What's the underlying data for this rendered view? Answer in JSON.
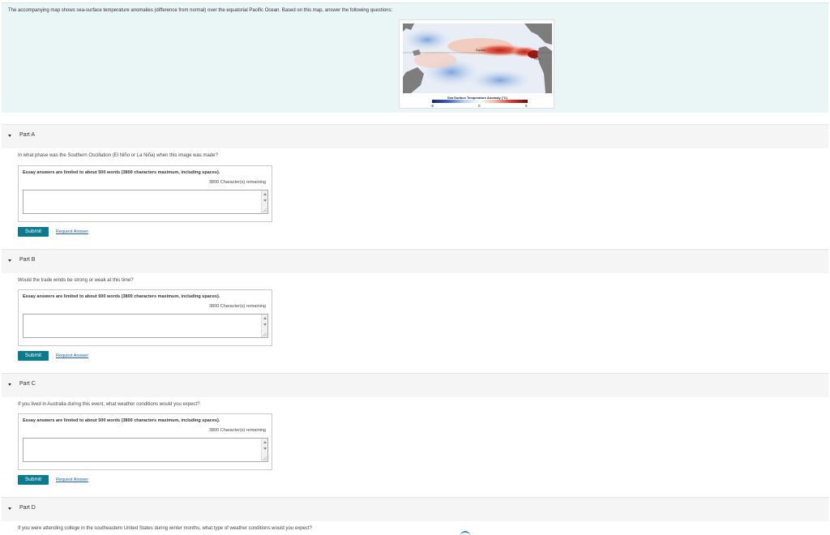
{
  "intro": {
    "text": "The accompanying map shows sea-surface temperature anomalies (difference from normal) over the equatorial Pacific Ocean. Based on this map, answer the following questions:",
    "map": {
      "equator_label": "Equator",
      "peru_label": "Peru",
      "legend_title": "Sea Surface Temperature Anomaly (°C)",
      "legend_min": "-5",
      "legend_mid": "0",
      "legend_max": "5"
    }
  },
  "parts": [
    {
      "title": "Part A",
      "question": "In what phase was the Southern Oscillation (El Niño or La Niña) when this image was made?",
      "limit": "Essay answers are limited to about 500 words (3800 characters maximum, including spaces).",
      "remaining": "3800 Character(s) remaining",
      "value": "",
      "submit": "Submit",
      "request": "Request Answer"
    },
    {
      "title": "Part B",
      "question": "Would the trade winds be strong or weak at this time?",
      "limit": "Essay answers are limited to about 500 words (3800 characters maximum, including spaces).",
      "remaining": "3800 Character(s) remaining",
      "value": "",
      "submit": "Submit",
      "request": "Request Answer"
    },
    {
      "title": "Part C",
      "question": "If you lived in Australia during this event, what weather conditions would you expect?",
      "limit": "Essay answers are limited to about 500 words (3800 characters maximum, including spaces).",
      "remaining": "3800 Character(s) remaining",
      "value": "",
      "submit": "Submit",
      "request": "Request Answer"
    },
    {
      "title": "Part D",
      "question": "If you were attending college in the southeastern United States during winter months, what type of weather conditions would you expect?"
    }
  ]
}
